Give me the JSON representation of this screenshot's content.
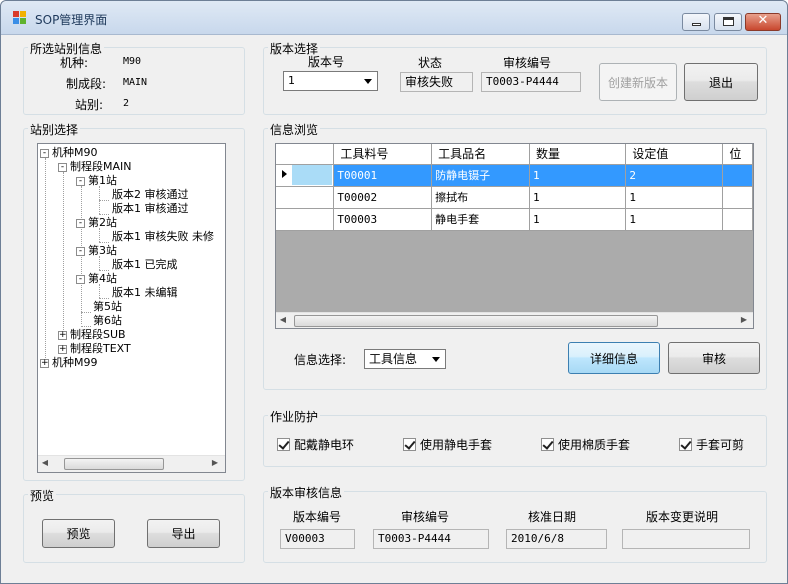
{
  "window": {
    "title": "SOP管理界面"
  },
  "station_info": {
    "group_title": "所选站别信息",
    "model_label": "机种:",
    "model_value": "M90",
    "segment_label": "制成段:",
    "segment_value": "MAIN",
    "station_label": "站别:",
    "station_value": "2"
  },
  "station_select": {
    "group_title": "站别选择",
    "tree": [
      {
        "text": "机种M90",
        "expander": "-"
      },
      {
        "text": "制程段MAIN",
        "expander": "-"
      },
      {
        "text": "第1站",
        "expander": "-"
      },
      {
        "text": "版本2 审核通过",
        "expander": ""
      },
      {
        "text": "版本1 审核通过",
        "expander": ""
      },
      {
        "text": "第2站",
        "expander": "-"
      },
      {
        "text": "版本1 审核失败 未修",
        "expander": ""
      },
      {
        "text": "第3站",
        "expander": "-"
      },
      {
        "text": "版本1 已完成",
        "expander": ""
      },
      {
        "text": "第4站",
        "expander": "-"
      },
      {
        "text": "版本1 未编辑",
        "expander": ""
      },
      {
        "text": "第5站",
        "expander": ""
      },
      {
        "text": "第6站",
        "expander": ""
      },
      {
        "text": "制程段SUB",
        "expander": "+"
      },
      {
        "text": "制程段TEXT",
        "expander": "+"
      },
      {
        "text": "机种M99",
        "expander": "+"
      }
    ]
  },
  "preview": {
    "group_title": "预览",
    "preview_button": "预览",
    "export_button": "导出"
  },
  "version_select": {
    "group_title": "版本选择",
    "version_label": "版本号",
    "version_value": "1",
    "status_label": "状态",
    "status_value": "审核失败",
    "audit_label": "审核编号",
    "audit_value": "T0003-P4444",
    "create_button": "创建新版本",
    "exit_button": "退出"
  },
  "info_browse": {
    "group_title": "信息浏览",
    "columns": [
      "工具料号",
      "工具品名",
      "数量",
      "设定值",
      "位"
    ],
    "rows": [
      {
        "part_no": "T00001",
        "name": "防静电镊子",
        "qty": "1",
        "setting": "2"
      },
      {
        "part_no": "T00002",
        "name": "擦拭布",
        "qty": "1",
        "setting": "1"
      },
      {
        "part_no": "T00003",
        "name": "静电手套",
        "qty": "1",
        "setting": "1"
      }
    ],
    "select_label": "信息选择:",
    "select_value": "工具信息",
    "detail_button": "详细信息",
    "audit_button": "审核"
  },
  "protection": {
    "group_title": "作业防护",
    "items": [
      {
        "label": "配戴静电环",
        "checked": true
      },
      {
        "label": "使用静电手套",
        "checked": true
      },
      {
        "label": "使用棉质手套",
        "checked": true
      },
      {
        "label": "手套可剪",
        "checked": true
      }
    ]
  },
  "audit_info": {
    "group_title": "版本审核信息",
    "version_no_label": "版本编号",
    "version_no_value": "V00003",
    "audit_no_label": "审核编号",
    "audit_no_value": "T0003-P4444",
    "date_label": "核准日期",
    "date_value": "2010/6/8",
    "desc_label": "版本变更说明",
    "desc_value": ""
  }
}
